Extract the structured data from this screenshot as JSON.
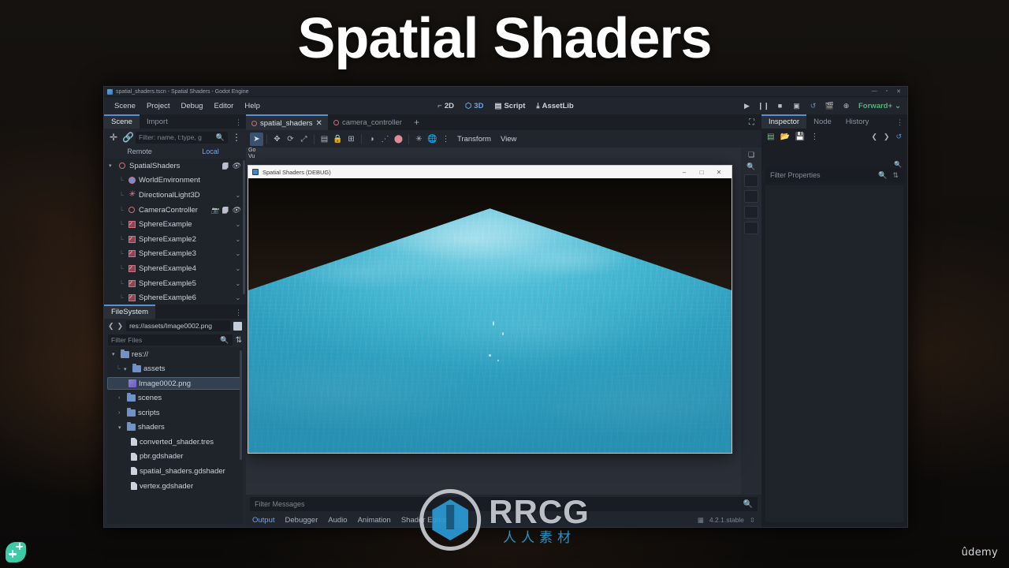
{
  "title": "Spatial Shaders",
  "window": {
    "titlebar": "spatial_shaders.tscn - Spatial Shaders - Godot Engine",
    "minimize": "—",
    "maximize": "▫",
    "close": "✕"
  },
  "menubar": {
    "items": [
      "Scene",
      "Project",
      "Debug",
      "Editor",
      "Help"
    ],
    "modes": [
      {
        "label": "2D",
        "icon": "2d-icon",
        "active": false
      },
      {
        "label": "3D",
        "icon": "3d-icon",
        "active": true
      },
      {
        "label": "Script",
        "icon": "script-icon",
        "active": false
      },
      {
        "label": "AssetLib",
        "icon": "assetlib-icon",
        "active": false
      }
    ],
    "run_controls": [
      "play-icon",
      "pause-icon",
      "stop-icon",
      "play-scene-icon",
      "reload-icon",
      "movie-icon",
      "remote-debug-icon"
    ],
    "renderer": "Forward+"
  },
  "scene_dock": {
    "tabs": [
      {
        "label": "Scene",
        "active": true
      },
      {
        "label": "Import",
        "active": false
      }
    ],
    "toolbar": [
      "add-node-icon",
      "instantiate-icon"
    ],
    "filter_placeholder": "Filter: name, t:type, g",
    "remote": "Remote",
    "local": "Local",
    "tree": [
      {
        "label": "SpatialShaders",
        "icon": "node3d-icon",
        "depth": 0,
        "arrow": "▾",
        "right": [
          "script-icon",
          "visibility-icon"
        ]
      },
      {
        "label": "WorldEnvironment",
        "icon": "world-icon",
        "depth": 1,
        "arrow": "",
        "right": []
      },
      {
        "label": "DirectionalLight3D",
        "icon": "light-icon",
        "depth": 1,
        "arrow": "",
        "right": [
          "chevron-icon"
        ]
      },
      {
        "label": "CameraController",
        "icon": "node3d-icon",
        "depth": 1,
        "arrow": "",
        "right": [
          "camera-icon",
          "script-icon",
          "visibility-icon"
        ]
      },
      {
        "label": "SphereExample",
        "icon": "mesh-icon",
        "depth": 1,
        "arrow": "",
        "right": [
          "chevron-icon"
        ]
      },
      {
        "label": "SphereExample2",
        "icon": "mesh-icon",
        "depth": 1,
        "arrow": "",
        "right": [
          "chevron-icon"
        ]
      },
      {
        "label": "SphereExample3",
        "icon": "mesh-icon",
        "depth": 1,
        "arrow": "",
        "right": [
          "chevron-icon"
        ]
      },
      {
        "label": "SphereExample4",
        "icon": "mesh-icon",
        "depth": 1,
        "arrow": "",
        "right": [
          "chevron-icon"
        ]
      },
      {
        "label": "SphereExample5",
        "icon": "mesh-icon",
        "depth": 1,
        "arrow": "",
        "right": [
          "chevron-icon"
        ]
      },
      {
        "label": "SphereExample6",
        "icon": "mesh-icon",
        "depth": 1,
        "arrow": "",
        "right": [
          "chevron-icon"
        ]
      }
    ]
  },
  "filesystem_dock": {
    "tab": "FileSystem",
    "path": "res://assets/Image0002.png",
    "filter_placeholder": "Filter Files",
    "tree": [
      {
        "label": "res://",
        "icon": "folder-icon",
        "depth": 0,
        "arrow": "▾",
        "selected": false
      },
      {
        "label": "assets",
        "icon": "folder-icon",
        "depth": 1,
        "arrow": "▾",
        "selected": false
      },
      {
        "label": "Image0002.png",
        "icon": "image-icon",
        "depth": 2,
        "arrow": "",
        "selected": true
      },
      {
        "label": "scenes",
        "icon": "folder-icon",
        "depth": 1,
        "arrow": "›",
        "selected": false
      },
      {
        "label": "scripts",
        "icon": "folder-icon",
        "depth": 1,
        "arrow": "›",
        "selected": false
      },
      {
        "label": "shaders",
        "icon": "folder-icon",
        "depth": 1,
        "arrow": "▾",
        "selected": false
      },
      {
        "label": "converted_shader.tres",
        "icon": "file-icon",
        "depth": 2,
        "arrow": "",
        "selected": false
      },
      {
        "label": "pbr.gdshader",
        "icon": "file-icon",
        "depth": 2,
        "arrow": "",
        "selected": false
      },
      {
        "label": "spatial_shaders.gdshader",
        "icon": "file-icon",
        "depth": 2,
        "arrow": "",
        "selected": false
      },
      {
        "label": "vertex.gdshader",
        "icon": "file-icon",
        "depth": 2,
        "arrow": "",
        "selected": false
      }
    ]
  },
  "scene_tabs": [
    {
      "label": "spatial_shaders",
      "active": true,
      "closable": true
    },
    {
      "label": "camera_controller",
      "active": false,
      "closable": false
    }
  ],
  "scene_tabs_add": "+",
  "viewport": {
    "toolbar_icons": [
      "select-icon",
      "move-icon",
      "rotate-icon",
      "scale-icon",
      "list-select-icon",
      "lock-icon",
      "group-icon",
      "ruler-icon",
      "snap-icon",
      "node-icon",
      "light-preview-icon",
      "globe-icon",
      "more-icon"
    ],
    "menus": [
      "Transform",
      "View"
    ],
    "overlay_info": [
      "Go",
      "Vu"
    ],
    "expand_icon": "fullscreen-icon"
  },
  "game_window": {
    "title": "Spatial Shaders (DEBUG)",
    "minimize": "–",
    "maximize": "□",
    "close": "✕"
  },
  "bottom_dock": {
    "filter_placeholder": "Filter Messages",
    "tabs": [
      {
        "label": "Output",
        "active": true
      },
      {
        "label": "Debugger",
        "active": false
      },
      {
        "label": "Audio",
        "active": false
      },
      {
        "label": "Animation",
        "active": false
      },
      {
        "label": "Shader Editor",
        "active": false
      }
    ],
    "version": "4.2.1.stable"
  },
  "inspector": {
    "tabs": [
      {
        "label": "Inspector",
        "active": true
      },
      {
        "label": "Node",
        "active": false
      },
      {
        "label": "History",
        "active": false
      }
    ],
    "tools": [
      "new-resource-icon",
      "open-resource-icon",
      "save-resource-icon",
      "more-icon"
    ],
    "nav": [
      "back-icon",
      "forward-icon",
      "history-icon"
    ],
    "side_icons": [
      "open-docs-icon",
      "object-menu-icon"
    ],
    "filter_placeholder": "Filter Properties"
  },
  "watermarks": {
    "rrcg_main": "RRCG",
    "rrcg_sub": "人人素材",
    "udemy": "ûdemy",
    "badge": "leaf-plus-badge"
  },
  "colors": {
    "accent_blue": "#6aa6e8",
    "panel_bg": "#21252d",
    "tree_bg": "#1f232a",
    "water": "#3fb2ce",
    "run_green": "#5cab7e"
  }
}
